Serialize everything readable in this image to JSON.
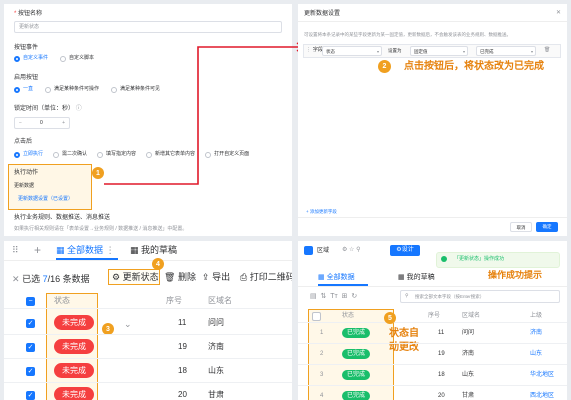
{
  "form": {
    "name_label": "按钮名称",
    "name_placeholder": "更新状态",
    "event_label": "按钮事件",
    "event_options": [
      "自定义事件",
      "自定义脚本"
    ],
    "enable_label": "启用按钮",
    "enable_options": [
      "一直",
      "满足某种条件可操作",
      "满足某种条件可见"
    ],
    "lock_label": "锁定时间（单位：秒）",
    "lock_value": "0",
    "after_click_label": "点击后",
    "after_click_options": [
      "立即执行",
      "需二次确认",
      "填写指定内容",
      "新增其它表单内容",
      "打开自定义页面"
    ],
    "action_label": "执行动作",
    "action_item": "更新数据",
    "action_sub": "更新数据设置（已设置）",
    "exec_text": "执行业务规则、数据推送、消息推送",
    "hint_text": "如果执行相关规则请在「表单设置→业务规则 / 数据推送 / 消息推送」中配置。"
  },
  "dialog": {
    "title": "更新数据设置",
    "desc": "可设置将本条记录中的某些字段更新为某一固定值，更新数据后，不会触发该表的业务规则、数据推送。",
    "row_field_label": "字段",
    "row_field_value": "状态",
    "row_setas": "设置为",
    "row_type": "固定值",
    "row_value": "已完成",
    "add_field": "+ 添加更新字段",
    "cancel": "取消",
    "ok": "确定"
  },
  "annotations": {
    "a1": "1",
    "a2": "2",
    "a2_text": "点击按钮后，将状态改为已完成",
    "a3": "3",
    "a4": "4",
    "a5": "5",
    "a5_text": "状态自动更改",
    "success_label": "操作成功提示"
  },
  "left_table": {
    "tabs": [
      "全部数据",
      "我的草稿"
    ],
    "selected_prefix": "已选",
    "selected_count": "7",
    "selected_total": "/16 条数据",
    "toolbar": [
      "更新状态",
      "删除",
      "导出",
      "打印二维码"
    ],
    "headers": [
      "状态",
      "序号",
      "区域名"
    ],
    "rows": [
      {
        "status": "未完成",
        "seq": "11",
        "area": "问问"
      },
      {
        "status": "未完成",
        "seq": "19",
        "area": "济南"
      },
      {
        "status": "未完成",
        "seq": "18",
        "area": "山东"
      },
      {
        "status": "未完成",
        "seq": "20",
        "area": "甘肃"
      }
    ],
    "status_color": "#f53f3f"
  },
  "right_table": {
    "app_title": "区域",
    "design_btn": "设计",
    "toast": "「更新状态」操作成功",
    "tabs": [
      "全部数据",
      "我的草稿"
    ],
    "search_placeholder": "搜索全部文本字段（按Enter搜索）",
    "headers": [
      "",
      "状态",
      "序号",
      "区域名",
      "上级"
    ],
    "rows": [
      {
        "n": "1",
        "status": "已完成",
        "seq": "11",
        "area": "问问",
        "parent": "济南"
      },
      {
        "n": "2",
        "status": "已完成",
        "seq": "19",
        "area": "济南",
        "parent": "山东"
      },
      {
        "n": "3",
        "status": "已完成",
        "seq": "18",
        "area": "山东",
        "parent": "华北地区"
      },
      {
        "n": "4",
        "status": "已完成",
        "seq": "20",
        "area": "甘肃",
        "parent": "西北地区"
      }
    ],
    "status_color": "#19be6b"
  }
}
